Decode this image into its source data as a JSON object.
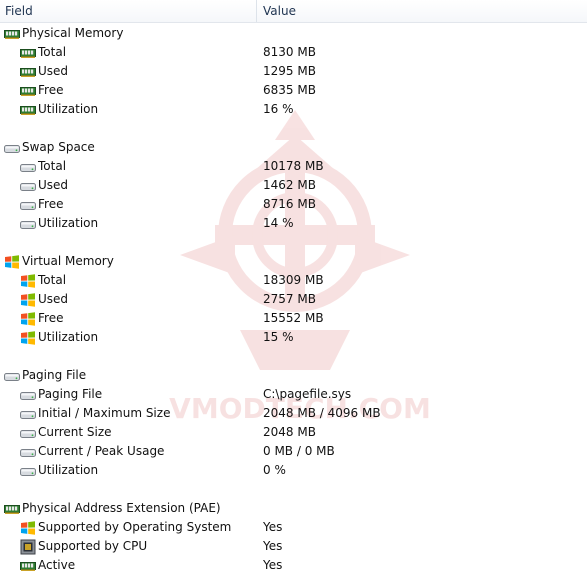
{
  "header": {
    "field": "Field",
    "value": "Value"
  },
  "watermark": {
    "text": "VMODTECH.COM"
  },
  "groups": [
    {
      "label": "Physical Memory",
      "icon": "ram-icon",
      "items": [
        {
          "label": "Total",
          "value": "8130 MB",
          "icon": "ram-icon"
        },
        {
          "label": "Used",
          "value": "1295 MB",
          "icon": "ram-icon"
        },
        {
          "label": "Free",
          "value": "6835 MB",
          "icon": "ram-icon"
        },
        {
          "label": "Utilization",
          "value": "16 %",
          "icon": "ram-icon"
        }
      ]
    },
    {
      "label": "Swap Space",
      "icon": "disk-icon",
      "items": [
        {
          "label": "Total",
          "value": "10178 MB",
          "icon": "disk-icon"
        },
        {
          "label": "Used",
          "value": "1462 MB",
          "icon": "disk-icon"
        },
        {
          "label": "Free",
          "value": "8716 MB",
          "icon": "disk-icon"
        },
        {
          "label": "Utilization",
          "value": "14 %",
          "icon": "disk-icon"
        }
      ]
    },
    {
      "label": "Virtual Memory",
      "icon": "windows-icon",
      "items": [
        {
          "label": "Total",
          "value": "18309 MB",
          "icon": "windows-icon"
        },
        {
          "label": "Used",
          "value": "2757 MB",
          "icon": "windows-icon"
        },
        {
          "label": "Free",
          "value": "15552 MB",
          "icon": "windows-icon"
        },
        {
          "label": "Utilization",
          "value": "15 %",
          "icon": "windows-icon"
        }
      ]
    },
    {
      "label": "Paging File",
      "icon": "disk-icon",
      "items": [
        {
          "label": "Paging File",
          "value": "C:\\pagefile.sys",
          "icon": "disk-icon"
        },
        {
          "label": "Initial / Maximum Size",
          "value": "2048 MB / 4096 MB",
          "icon": "disk-icon"
        },
        {
          "label": "Current Size",
          "value": "2048 MB",
          "icon": "disk-icon"
        },
        {
          "label": "Current / Peak Usage",
          "value": "0 MB / 0 MB",
          "icon": "disk-icon"
        },
        {
          "label": "Utilization",
          "value": "0 %",
          "icon": "disk-icon"
        }
      ]
    },
    {
      "label": "Physical Address Extension (PAE)",
      "icon": "ram-icon",
      "items": [
        {
          "label": "Supported by Operating System",
          "value": "Yes",
          "icon": "windows-icon"
        },
        {
          "label": "Supported by CPU",
          "value": "Yes",
          "icon": "cpu-icon"
        },
        {
          "label": "Active",
          "value": "Yes",
          "icon": "ram-icon"
        }
      ]
    }
  ]
}
